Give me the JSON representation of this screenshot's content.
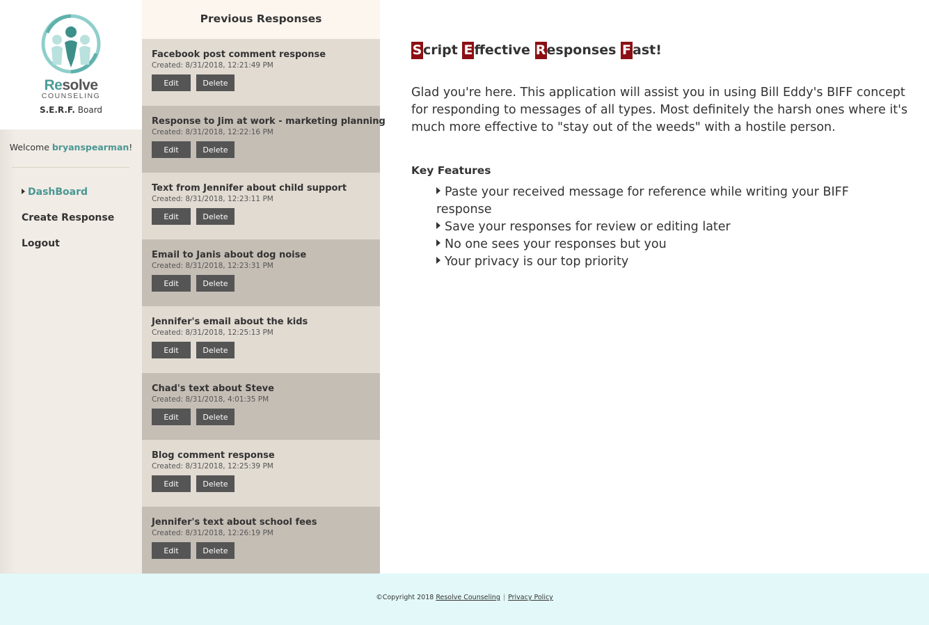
{
  "brand": {
    "name_accent": "Re",
    "name_rest": "solve",
    "subtitle": "COUNSELING",
    "board_bold": "S.E.R.F.",
    "board_rest": "Board"
  },
  "welcome": {
    "prefix": "Welcome ",
    "username": "bryanspearman",
    "suffix": "!"
  },
  "nav": {
    "dashboard": "DashBoard",
    "create": "Create Response",
    "logout": "Logout"
  },
  "responses": {
    "header": "Previous Responses",
    "edit_label": "Edit",
    "delete_label": "Delete",
    "items": [
      {
        "title": "Facebook post comment response",
        "created": "Created: 8/31/2018, 12:21:49 PM"
      },
      {
        "title": "Response to Jim at work - marketing planning",
        "created": "Created: 8/31/2018, 12:22:16 PM"
      },
      {
        "title": "Text from Jennifer about child support",
        "created": "Created: 8/31/2018, 12:23:11 PM"
      },
      {
        "title": "Email to Janis about dog noise",
        "created": "Created: 8/31/2018, 12:23:31 PM"
      },
      {
        "title": "Jennifer's email about the kids",
        "created": "Created: 8/31/2018, 12:25:13 PM"
      },
      {
        "title": "Chad's text about Steve",
        "created": "Created: 8/31/2018, 4:01:35 PM"
      },
      {
        "title": "Blog comment response",
        "created": "Created: 8/31/2018, 12:25:39 PM"
      },
      {
        "title": "Jennifer's text about school fees",
        "created": "Created: 8/31/2018, 12:26:19 PM"
      }
    ]
  },
  "main": {
    "headline": [
      {
        "cap": "S",
        "rest": "cript"
      },
      {
        "cap": "E",
        "rest": "ffective"
      },
      {
        "cap": "R",
        "rest": "esponses"
      },
      {
        "cap": "F",
        "rest": "ast!"
      }
    ],
    "intro": "Glad you're here. This application will assist you in using Bill Eddy's BIFF concept for responding to messages of all types. Most definitely the harsh ones where it's much more effective to \"stay out of the weeds\" with a hostile person.",
    "features_title": "Key Features",
    "features": [
      "Paste your received message for reference while writing your BIFF response",
      "Save your responses for review or editing later",
      "No one sees your responses but you",
      "Your privacy is our top priority"
    ]
  },
  "footer": {
    "copyright": "©Copyright 2018 ",
    "company_link": "Resolve Counseling",
    "separator": "|",
    "privacy_link": "Privacy Policy"
  },
  "colors": {
    "accent_teal": "#4a9693",
    "headline_red": "#8c0f14",
    "button_dark": "#555555",
    "footer_bg": "#e3f8f8"
  }
}
